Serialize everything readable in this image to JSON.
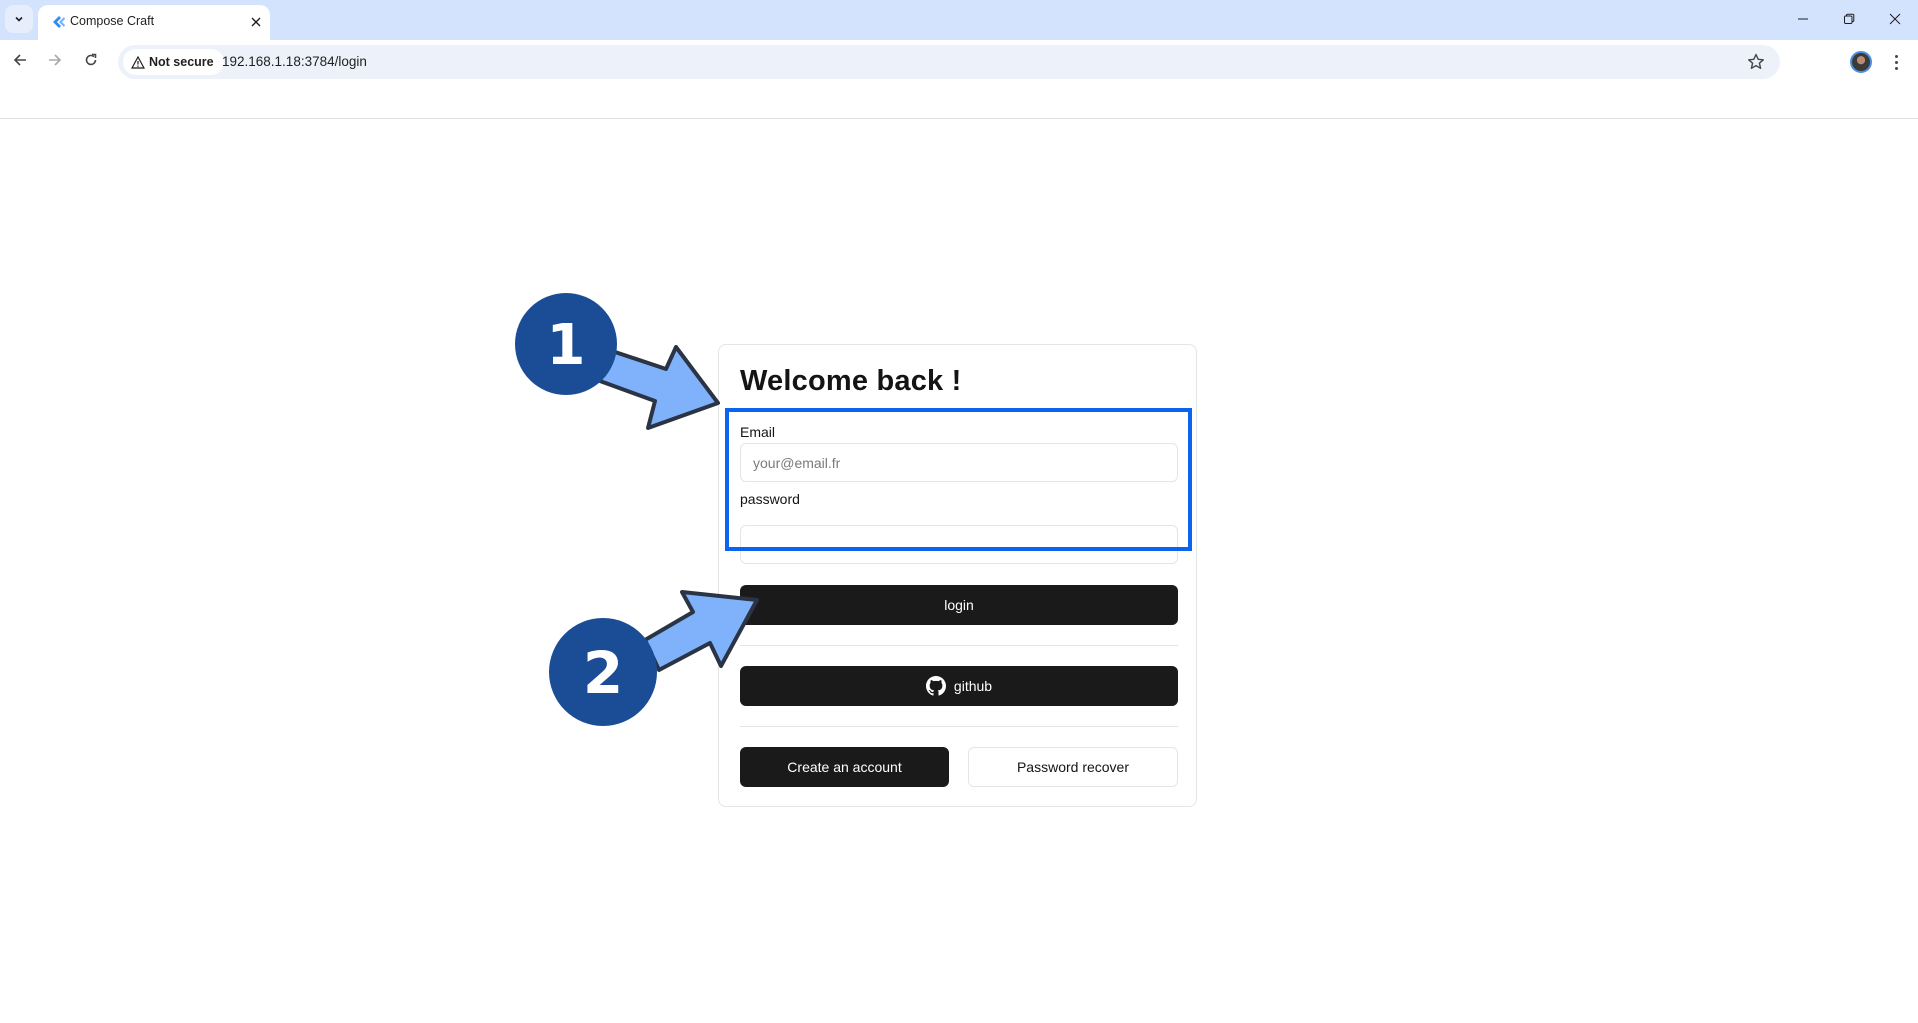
{
  "browser": {
    "tab": {
      "title": "Compose Craft",
      "favicon": "compose-craft-logo-icon"
    },
    "security_label": "Not secure",
    "url": "192.168.1.18:3784/login",
    "icons": {
      "tab_dropdown": "chevron-down-icon",
      "tab_close": "close-icon",
      "back": "arrow-left-icon",
      "forward": "arrow-right-icon",
      "reload": "reload-icon",
      "security": "warning-triangle-icon",
      "bookmark": "star-icon",
      "profile": "avatar-icon",
      "menu": "kebab-menu-icon",
      "minimize": "minimize-icon",
      "restore": "restore-icon",
      "close_window": "close-icon"
    }
  },
  "login_form": {
    "heading": "Welcome back !",
    "email": {
      "label": "Email",
      "placeholder": "your@email.fr",
      "value": ""
    },
    "password": {
      "label": "password",
      "placeholder": "",
      "value": ""
    },
    "login_button": "login",
    "github_button": "github",
    "create_account_button": "Create an account",
    "password_recover_button": "Password recover"
  },
  "annotations": {
    "step1": "1",
    "step2": "2",
    "colors": {
      "badge": "#1b4d97",
      "arrow_fill": "#7fb2fb",
      "arrow_stroke": "#2b3445",
      "highlight": "#0a64f0"
    }
  }
}
